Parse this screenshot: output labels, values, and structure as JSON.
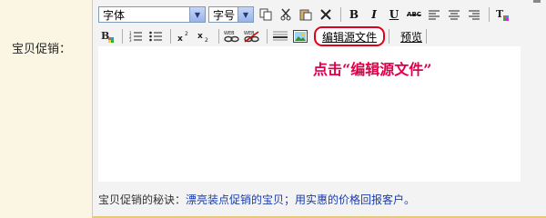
{
  "form": {
    "label": "宝贝促销："
  },
  "toolbar": {
    "font_select": "字体",
    "size_select": "字号",
    "edit_source": "编辑源文件",
    "preview": "预览"
  },
  "hint": "点击“编辑源文件”",
  "footnote": {
    "prefix": "宝贝促销的秘诀：",
    "tip": "漂亮装点促销的宝贝；用实惠的价格回报客户。"
  },
  "colors": {
    "hint_red": "#e0004a",
    "highlight_ring": "#e0001b",
    "link_blue": "#1a3cab"
  }
}
